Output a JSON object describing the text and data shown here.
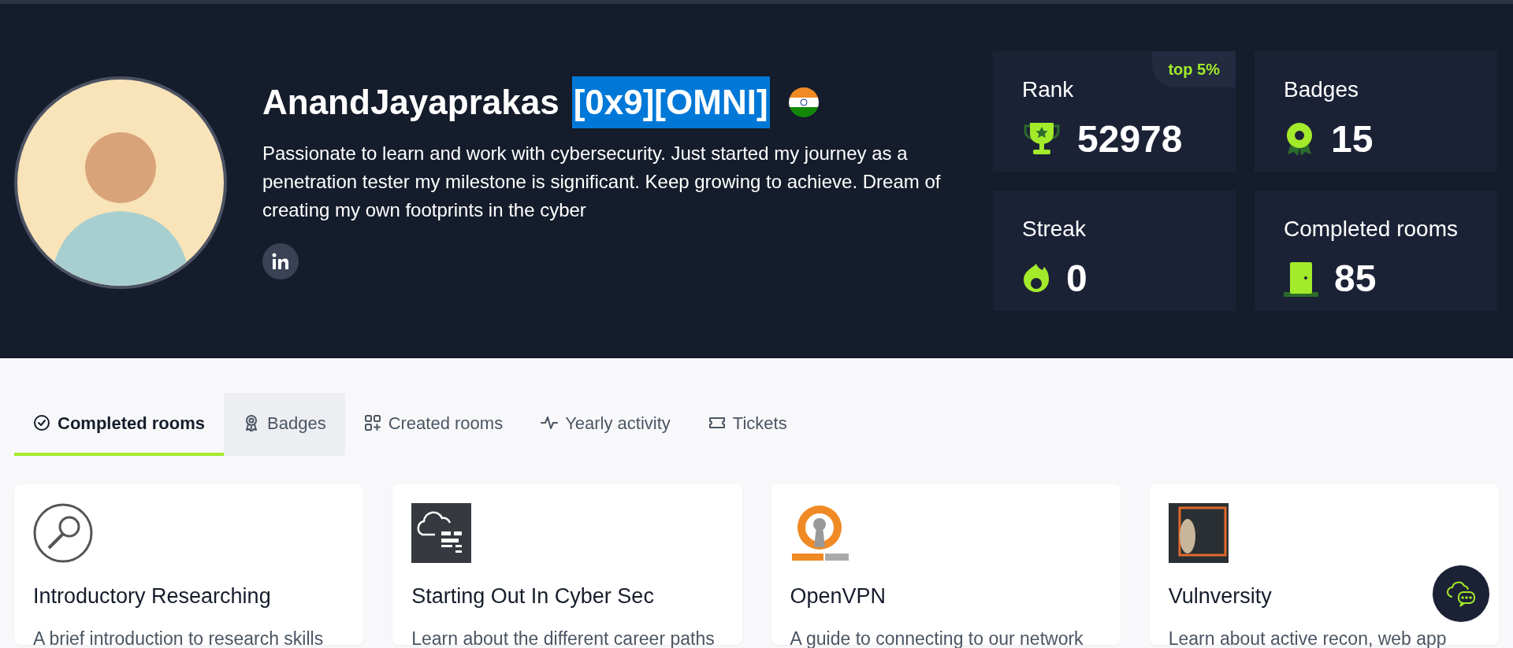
{
  "profile": {
    "username": "AnandJayaprakas",
    "tag": "[0x9][OMNI]",
    "tag_highlighted": true,
    "bio": "Passionate to learn and work with cybersecurity. Just started my journey as a penetration tester my milestone is significant. Keep growing to achieve. Dream of creating my own footprints in the cyber"
  },
  "stats": [
    {
      "kind": "rank",
      "label": "Rank",
      "value": "52978",
      "badge": "top 5%"
    },
    {
      "kind": "badges",
      "label": "Badges",
      "value": "15"
    },
    {
      "kind": "streak",
      "label": "Streak",
      "value": "0"
    },
    {
      "kind": "rooms",
      "label": "Completed rooms",
      "value": "85"
    }
  ],
  "tabs": [
    {
      "kind": "check",
      "label": "Completed rooms",
      "selected": true,
      "hovered": false
    },
    {
      "kind": "badge",
      "label": "Badges",
      "selected": false,
      "hovered": true
    },
    {
      "kind": "grid",
      "label": "Created rooms",
      "selected": false,
      "hovered": false
    },
    {
      "kind": "pulse",
      "label": "Yearly activity",
      "selected": false,
      "hovered": false
    },
    {
      "kind": "ticket",
      "label": "Tickets",
      "selected": false,
      "hovered": false
    }
  ],
  "rooms": [
    {
      "kind": "magnifier",
      "title": "Introductory Researching",
      "description": "A brief introduction to research skills"
    },
    {
      "kind": "cloud",
      "title": "Starting Out In Cyber Sec",
      "description": "Learn about the different career paths"
    },
    {
      "kind": "openvpn",
      "title": "OpenVPN",
      "description": "A guide to connecting to our network"
    },
    {
      "kind": "photo",
      "title": "Vulnversity",
      "description": "Learn about active recon, web app"
    }
  ]
}
